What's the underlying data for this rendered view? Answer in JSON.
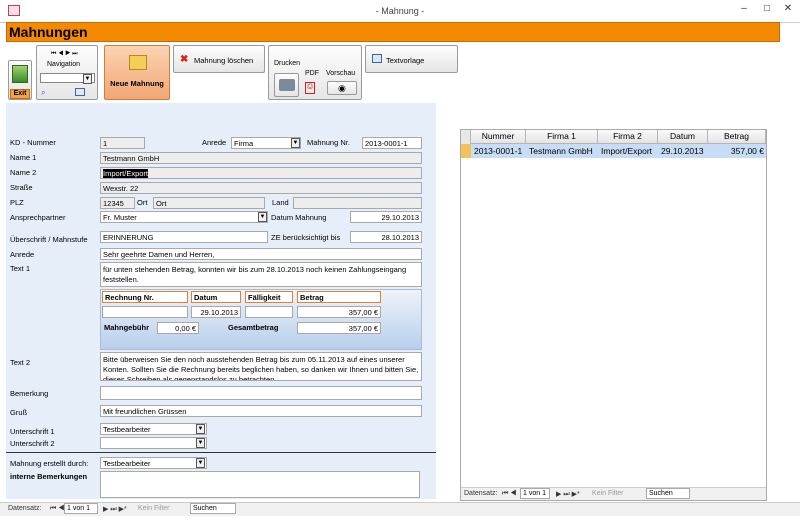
{
  "window": {
    "title": "- Mahnung -",
    "minimize": "–",
    "maximize": "□",
    "close": "✕"
  },
  "form": {
    "header": "Mahnungen"
  },
  "toolbar": {
    "exit": "Exit",
    "navigation": "Navigation",
    "new": "Neue Mahnung",
    "delete": "Mahnung löschen",
    "print": "Drucken",
    "pdf": "PDF",
    "preview": "Vorschau",
    "template": "Textvorlage"
  },
  "fields": {
    "kd_label": "KD - Nummer",
    "kd": "1",
    "anrede_label": "Anrede",
    "anrede": "Firma",
    "mahnnr_label": "Mahnung Nr.",
    "mahnnr": "2013-0001-1",
    "name1_label": "Name 1",
    "name1": "Testmann GmbH",
    "name2_label": "Name 2",
    "name2": "Import/Export",
    "strasse_label": "Straße",
    "strasse": "Wexstr. 22",
    "plz_label": "PLZ",
    "plz": "12345",
    "ort_label": "Ort",
    "ort": "Ort",
    "land_label": "Land",
    "land": "",
    "ansprech_label": "Ansprechpartner",
    "ansprech": "Fr. Muster",
    "datum_label": "Datum Mahnung",
    "datum": "29.10.2013",
    "ueber_label": "Überschrift / Mahnstufe",
    "ueber": "ERINNERUNG",
    "ze_label": "ZE berücksichtigt bis",
    "ze": "28.10.2013",
    "anrede2_label": "Anrede",
    "anrede2": "Sehr geehrte Damen und Herren,",
    "text1_label": "Text 1",
    "text1": "für unten stehenden Betrag, konnten wir bis zum 28.10.2013 noch keinen Zahlungseingang feststellen.",
    "text2_label": "Text 2",
    "text2": "Bitte überweisen Sie den noch ausstehenden Betrag bis zum 05.11.2013 auf eines unserer Konten. Sollten Sie die Rechnung bereits beglichen haben, so danken wir Ihnen und bitten Sie, dieses Schreiben als gegenstandslos zu betrachten.",
    "bemerkung_label": "Bemerkung",
    "bemerkung": "",
    "gruss_label": "Gruß",
    "gruss": "Mit freundlichen Grüssen",
    "u1_label": "Unterschrift 1",
    "u1": "Testbearbeiter",
    "u2_label": "Unterschrift 2",
    "u2": "",
    "erstellt_label": "Mahnung erstellt durch:",
    "erstellt": "Testbearbeiter",
    "intern_label": "interne Bemerkungen",
    "intern": ""
  },
  "invoice": {
    "h_nr": "Rechnung Nr.",
    "h_datum": "Datum",
    "h_faell": "Fälligkeit",
    "h_betrag": "Betrag",
    "nr": "",
    "datum": "29.10.2013",
    "faell": "",
    "betrag": "357,00 €",
    "gebuehr_label": "Mahngebühr",
    "gebuehr": "0,00 €",
    "gesamt_label": "Gesamtbetrag",
    "gesamt": "357,00 €"
  },
  "grid": {
    "headers": [
      "Nummer",
      "Firma 1",
      "Firma 2",
      "Datum",
      "Betrag"
    ],
    "row": [
      "2013-0001-1",
      "Testmann GmbH",
      "Import/Export",
      "29.10.2013",
      "357,00 €"
    ]
  },
  "nav_main": {
    "label": "Datensatz:",
    "pos": "1 von 1",
    "filter": "Kein Filter",
    "search": "Suchen"
  },
  "nav_grid": {
    "label": "Datensatz:",
    "pos": "1 von 1",
    "filter": "Kein Filter",
    "search": "Suchen"
  }
}
